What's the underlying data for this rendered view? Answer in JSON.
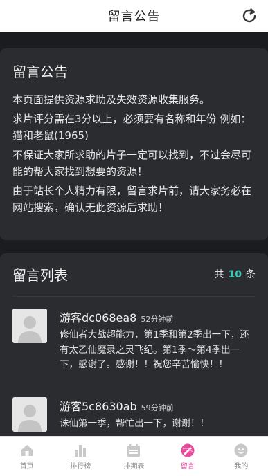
{
  "header": {
    "title": "留言公告",
    "refresh_icon": "refresh-icon"
  },
  "notice": {
    "title": "留言公告",
    "paragraphs": [
      "本页面提供资源求助及失效资源收集服务。",
      "求片评分需在3分以上，必须要有名称和年份 例如：猫和老鼠(1965)",
      "不保证大家所求助的片子一定可以找到，不过会尽可能的帮大家找到想要的资源！",
      "由于站长个人精力有限，留言求片前，请大家务必在网站搜索，确认无此资源后求助！"
    ]
  },
  "list": {
    "title": "留言列表",
    "count_prefix": "共",
    "count": "10",
    "count_suffix": "条",
    "items": [
      {
        "user": "游客dc068ea8",
        "time": "52分钟前",
        "text": "修仙者大战超能力，第1季和第2季出一下，还有太乙仙魔录之灵飞纪。第1季～第4季出一下，感谢了。感谢！！祝您辛苦愉快！！"
      },
      {
        "user": "游客5c8630ab",
        "time": "59分钟前",
        "text": "诛仙第一季，帮忙出一下，谢谢！！"
      }
    ]
  },
  "tabs": [
    {
      "label": "首页",
      "icon": "home-icon",
      "active": false
    },
    {
      "label": "排行榜",
      "icon": "ranking-icon",
      "active": false
    },
    {
      "label": "排期表",
      "icon": "schedule-icon",
      "active": false
    },
    {
      "label": "留言",
      "icon": "message-icon",
      "active": true
    },
    {
      "label": "我的",
      "icon": "profile-icon",
      "active": false
    }
  ],
  "colors": {
    "accent": "#e94b9c",
    "count_highlight": "#39c9b8",
    "background": "#1b1c20",
    "card": "#2a2c30"
  }
}
